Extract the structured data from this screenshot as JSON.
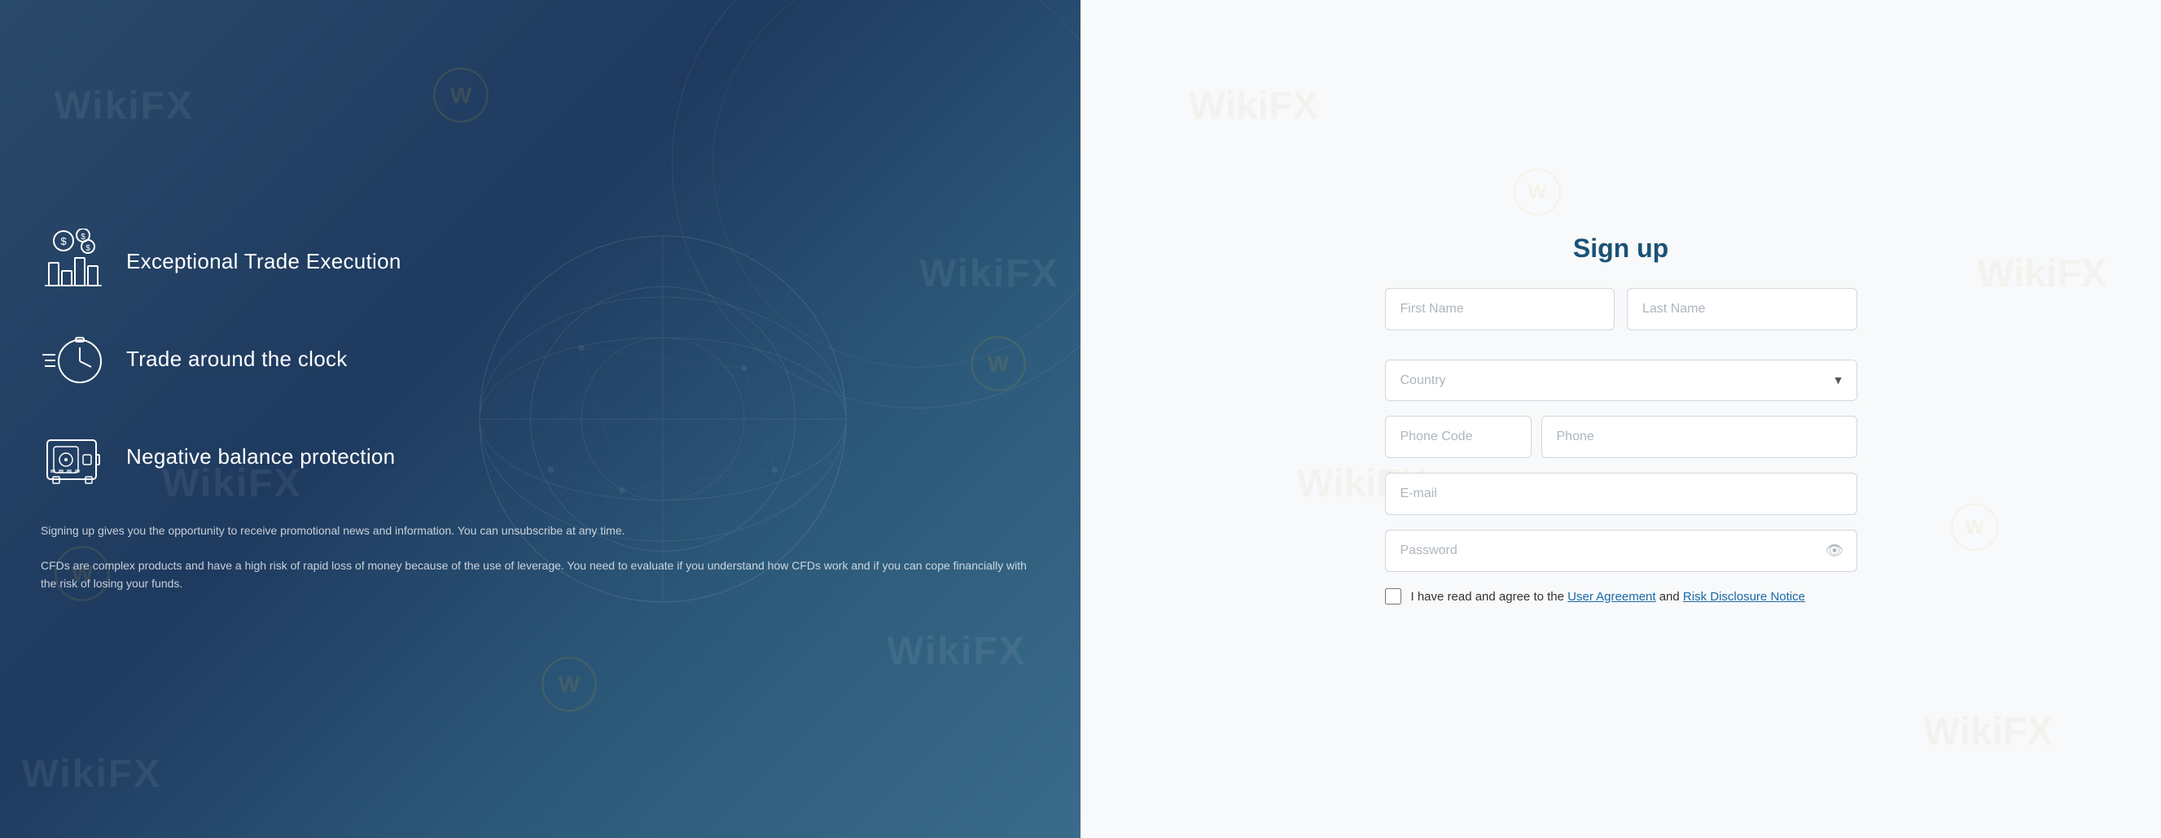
{
  "left": {
    "features": [
      {
        "id": "trade-execution",
        "text": "Exceptional Trade Execution",
        "icon": "chart-icon"
      },
      {
        "id": "trade-clock",
        "text": "Trade around the clock",
        "icon": "clock-icon"
      },
      {
        "id": "negative-balance",
        "text": "Negative balance protection",
        "icon": "safe-icon"
      }
    ],
    "disclaimer1": "Signing up gives you the opportunity to receive promotional news and information. You can unsubscribe at any time.",
    "disclaimer2": "CFDs are complex products and have a high risk of rapid loss of money because of the use of leverage. You need to evaluate if you understand how CFDs work and if you can cope financially with the risk of losing your funds.",
    "watermarks": [
      "WikiFX",
      "WikiFX",
      "WikiFX",
      "WikiFX",
      "WikiFX"
    ]
  },
  "right": {
    "title": "Sign up",
    "form": {
      "first_name_placeholder": "First Name",
      "last_name_placeholder": "Last Name",
      "country_placeholder": "Country",
      "phone_code_placeholder": "Phone Code",
      "phone_placeholder": "Phone",
      "email_placeholder": "E-mail",
      "password_placeholder": "Password"
    },
    "checkbox_text": "I have read and agree to the ",
    "user_agreement_label": "User Agreement",
    "and_label": " and ",
    "risk_disclosure_label": "Risk Disclosure Notice",
    "watermarks": [
      "WikiFX",
      "WikiFX",
      "WikiFX",
      "WikiFX"
    ]
  }
}
